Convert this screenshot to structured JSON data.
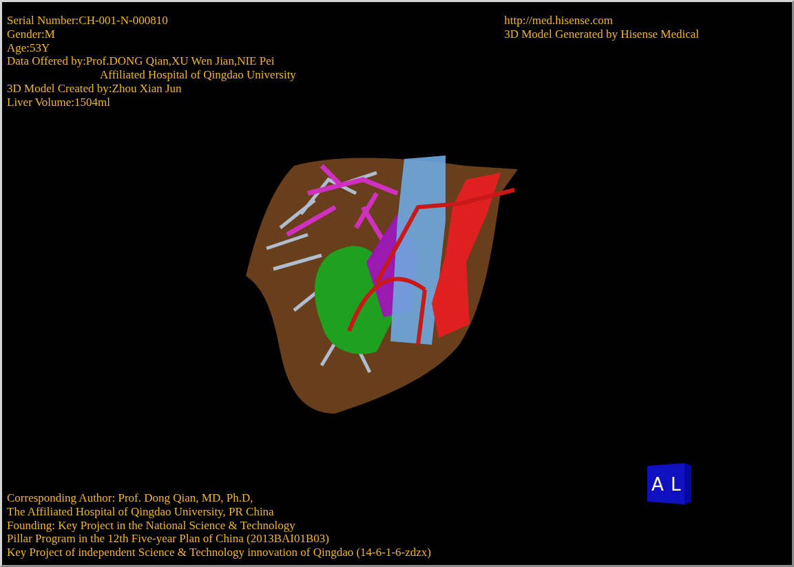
{
  "patient_info": [
    {
      "kind": "line",
      "text": "Serial Number:CH-001-N-000810"
    },
    {
      "kind": "line",
      "text": "Gender:M"
    },
    {
      "kind": "line",
      "text": "Age:53Y"
    },
    {
      "kind": "line",
      "text": "Data Offered by:Prof.DONG Qian,XU Wen Jian,NIE Pei"
    },
    {
      "kind": "continued",
      "text": "Affiliated Hospital of Qingdao University"
    },
    {
      "kind": "line",
      "text": "3D Model Created by:Zhou Xian Jun"
    },
    {
      "kind": "line",
      "text": "Liver Volume:1504ml"
    }
  ],
  "generator": {
    "url": "http://med.hisense.com",
    "text": "3D Model Generated by Hisense Medical"
  },
  "credits": [
    "Corresponding Author: Prof. Dong Qian, MD, Ph.D,",
    "The Affiliated Hospital of Qingdao University, PR China",
    "Founding: Key Project in the National Science & Technology",
    "Pillar Program in the 12th Five-year Plan of China (2013BAI01B03)",
    "Key Project of independent Science & Technology innovation of Qingdao (14-6-1-6-zdzx)"
  ],
  "orientation_cube": {
    "front": "A",
    "side": "L"
  }
}
